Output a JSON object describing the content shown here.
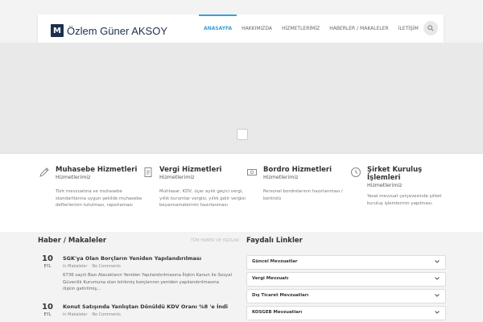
{
  "header": {
    "logo_text": "Özlem Güner AKSOY",
    "nav": [
      {
        "label": "ANASAYFA",
        "active": true
      },
      {
        "label": "HAKKIMIZDA",
        "active": false
      },
      {
        "label": "HİZMETLERİMİZ",
        "active": false
      },
      {
        "label": "HABERLER / MAKALELER",
        "active": false
      },
      {
        "label": "İLETİŞİM",
        "active": false
      }
    ],
    "accent": "#3aa0d6"
  },
  "services": [
    {
      "title": "Muhasebe Hizmetleri",
      "sub": "Hizmetlerimiz",
      "desc": "Türk mevzuatına ve muhasebe standartlarına uygun şekilde muhasebe defterlerinin tutulması, raporlaması",
      "icon": "pencil-icon"
    },
    {
      "title": "Vergi Hizmetleri",
      "sub": "Hizmetlerimiz",
      "desc": "Muhtasar, KDV, üçer aylık geçici vergi, yıllık kurumlar vergisi, yıllık gelir vergisi beyannamelerinin hazırlanması",
      "icon": "document-icon"
    },
    {
      "title": "Bordro Hizmetleri",
      "sub": "Hizmetlerimiz",
      "desc": "Personel bordrolarının hazırlanması / kontrolü",
      "icon": "money-icon"
    },
    {
      "title": "Şirket Kuruluş İşlemleri",
      "sub": "Hizmetlerimiz",
      "desc": "Yasal mevzuat çerçevesinde şirket kuruluş işlemlerinin yapılması.",
      "icon": "clock-icon"
    }
  ],
  "news": {
    "title": "Haber / Makaleler",
    "more": "TÜM HABER VE YAZILAR",
    "items": [
      {
        "day": "10",
        "month": "EYL",
        "title": "SGK'ya Olan Borçların Yeniden Yapılandırılması",
        "category": "in Makaleler",
        "comments": "No Comments",
        "excerpt": "6736 sayılı Bazı Alacakların Yeniden Yapılandırılmasına İlişkin Kanun ile Sosyal Güvenlik Kurumuna olan birikmiş borçlarının yeniden yapılandırılmasına ilişkin getirilmiş..."
      },
      {
        "day": "10",
        "month": "EYL",
        "title": "Konut Satışında Yanlıştan Dönüldü KDV Oranı %8 'e İndi",
        "category": "in Makaleler",
        "comments": "No Comments",
        "excerpt": ""
      }
    ]
  },
  "links": {
    "title": "Faydalı Linkler",
    "items": [
      "Güncel Mevzuatlar",
      "Vergi Mevzuatı",
      "Dış Ticaret Mevzuatları",
      "KOSGEB Mevzuatları"
    ]
  }
}
